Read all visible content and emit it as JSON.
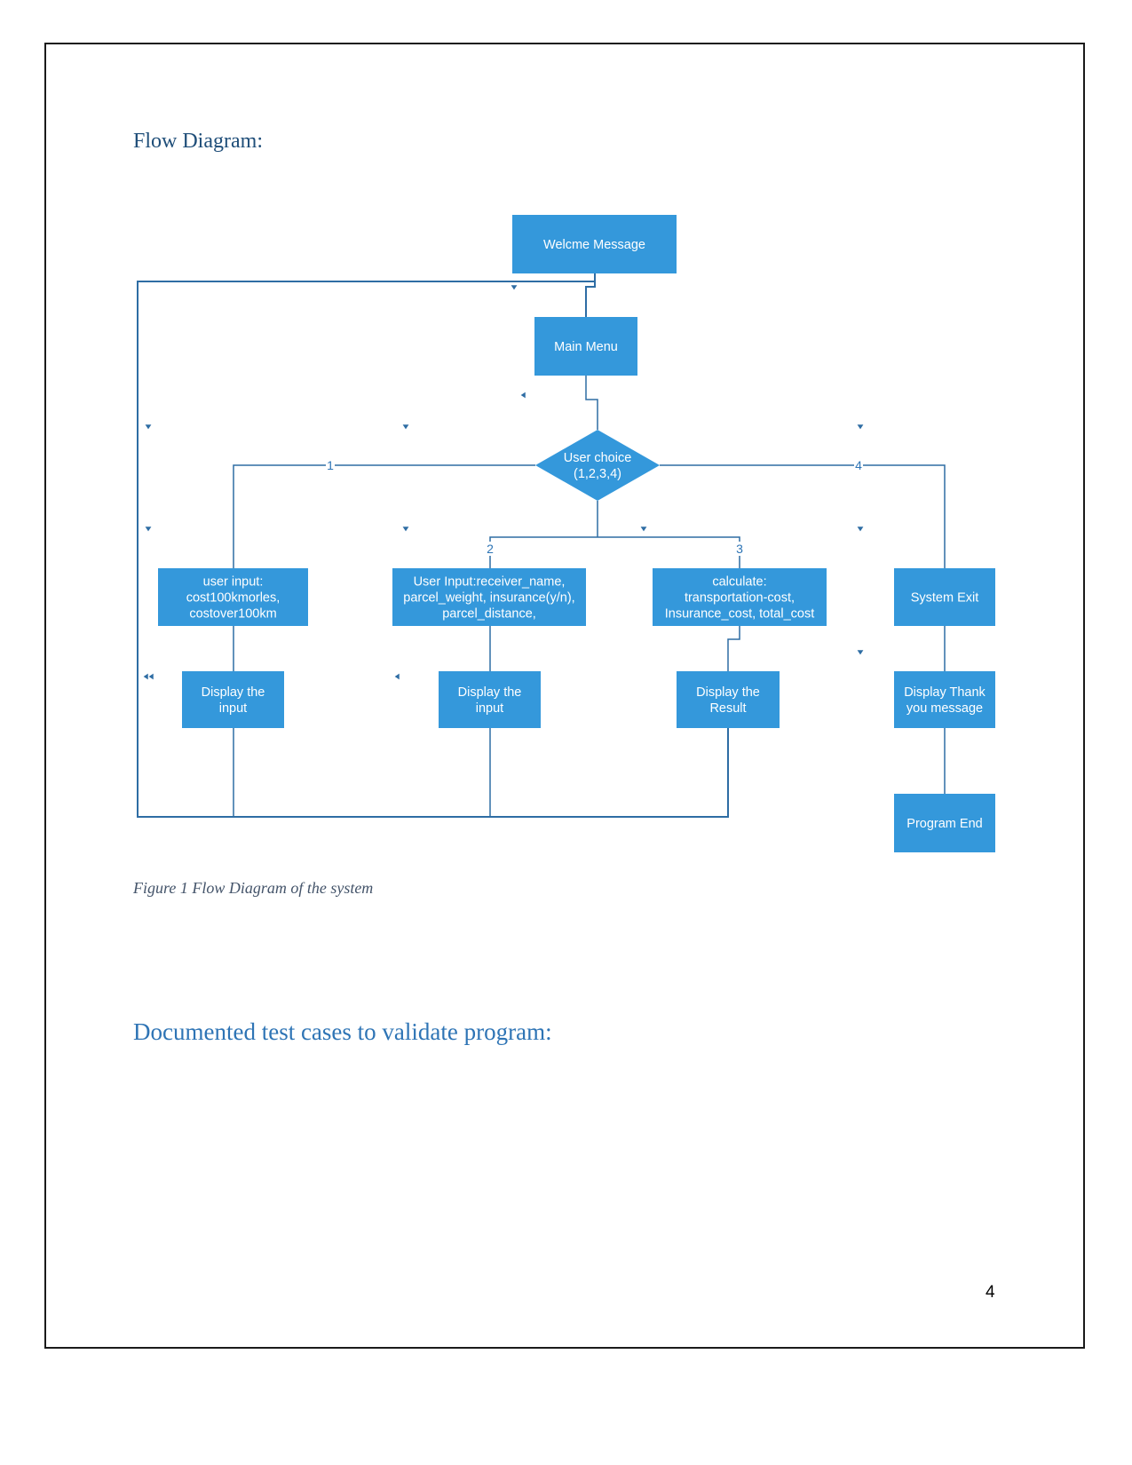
{
  "headings": {
    "flow_diagram": "Flow Diagram:",
    "test_cases": "Documented test cases to validate program:"
  },
  "caption": "Figure 1 Flow Diagram of the system",
  "page_number": "4",
  "colors": {
    "node_fill": "#3498db",
    "connector": "#2e6da4",
    "node_text": "#ffffff"
  },
  "diagram": {
    "nodes": [
      {
        "id": "welcome",
        "shape": "rect",
        "lines": [
          "Welcme Message"
        ]
      },
      {
        "id": "main-menu",
        "shape": "rect",
        "lines": [
          "Main Menu"
        ]
      },
      {
        "id": "user-choice",
        "shape": "diamond",
        "lines": [
          "User choice",
          "(1,2,3,4)"
        ]
      },
      {
        "id": "user-input-1",
        "shape": "rect",
        "lines": [
          "user input:",
          "cost100kmorles,",
          "costover100km"
        ]
      },
      {
        "id": "user-input-2",
        "shape": "rect",
        "lines": [
          "User Input:receiver_name,",
          "parcel_weight, insurance(y/n),",
          "parcel_distance,"
        ]
      },
      {
        "id": "calculate",
        "shape": "rect",
        "lines": [
          "calculate:",
          "transportation-cost,",
          "Insurance_cost, total_cost"
        ]
      },
      {
        "id": "system-exit",
        "shape": "rect",
        "lines": [
          "System Exit"
        ]
      },
      {
        "id": "display-input-1",
        "shape": "rect",
        "lines": [
          "Display the",
          "input"
        ]
      },
      {
        "id": "display-input-2",
        "shape": "rect",
        "lines": [
          "Display the",
          "input"
        ]
      },
      {
        "id": "display-result",
        "shape": "rect",
        "lines": [
          "Display the",
          "Result"
        ]
      },
      {
        "id": "display-thank-you",
        "shape": "rect",
        "lines": [
          "Display Thank",
          "you message"
        ]
      },
      {
        "id": "program-end",
        "shape": "rect",
        "lines": [
          "Program End"
        ]
      }
    ],
    "edge_labels": {
      "choice_1": "1",
      "choice_2": "2",
      "choice_3": "3",
      "choice_4": "4"
    }
  }
}
